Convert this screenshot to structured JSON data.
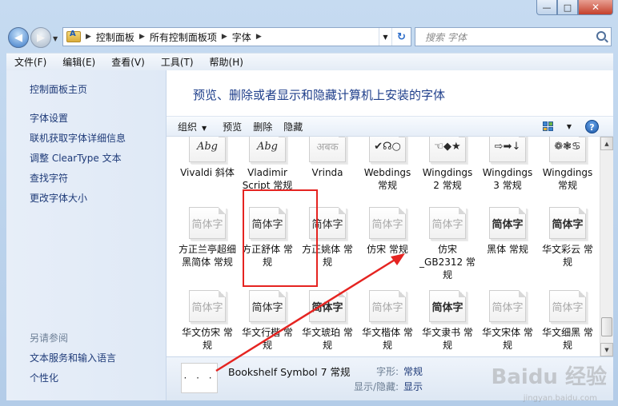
{
  "window": {
    "caption": {
      "minimize": "—",
      "maximize": "□",
      "close": "✕"
    }
  },
  "nav": {
    "back": "◀",
    "forward": "▶",
    "breadcrumbs": [
      "控制面板",
      "所有控制面板项",
      "字体"
    ],
    "search_placeholder": "搜索 字体"
  },
  "menu": [
    "文件(F)",
    "编辑(E)",
    "查看(V)",
    "工具(T)",
    "帮助(H)"
  ],
  "left_pane": {
    "links": [
      "控制面板主页",
      "字体设置",
      "联机获取字体详细信息",
      "调整 ClearType 文本",
      "查找字符",
      "更改字体大小"
    ],
    "see_also_heading": "另请参阅",
    "see_also_links": [
      "文本服务和输入语言",
      "个性化"
    ]
  },
  "main": {
    "title": "预览、删除或者显示和隐藏计算机上安装的字体",
    "commands": {
      "organize": "组织",
      "preview": "预览",
      "delete": "删除",
      "hide": "隐藏"
    },
    "help": "?"
  },
  "fonts": [
    {
      "glyph": "Abg",
      "style": "italic",
      "label": "Vivaldi 斜体"
    },
    {
      "glyph": "Abg",
      "style": "italic",
      "label": "Vladimir Script 常规"
    },
    {
      "glyph": "अबक",
      "style": "light",
      "label": "Vrinda"
    },
    {
      "glyph": "✔☊○",
      "style": "",
      "label": "Webdings 常规"
    },
    {
      "glyph": "☜◆★",
      "style": "",
      "label": "Wingdings 2 常规"
    },
    {
      "glyph": "⇨➡↓",
      "style": "",
      "label": "Wingdings 3 常规"
    },
    {
      "glyph": "❁❃♋",
      "style": "",
      "label": "Wingdings 常规"
    },
    {
      "glyph": "简体字",
      "style": "light",
      "label": "方正兰亭超细黑简体 常规"
    },
    {
      "glyph": "简体字",
      "style": "serif",
      "label": "方正舒体 常规"
    },
    {
      "glyph": "简体字",
      "style": "",
      "label": "方正姚体 常规"
    },
    {
      "glyph": "简体字",
      "style": "light",
      "label": "仿宋 常规"
    },
    {
      "glyph": "简体字",
      "style": "light",
      "label": "仿宋_GB2312 常规"
    },
    {
      "glyph": "简体字",
      "style": "bold",
      "label": "黑体 常规"
    },
    {
      "glyph": "简体字",
      "style": "bold",
      "label": "华文彩云 常规"
    },
    {
      "glyph": "简体字",
      "style": "light",
      "label": "华文仿宋 常规"
    },
    {
      "glyph": "简体字",
      "style": "serif",
      "label": "华文行楷 常规"
    },
    {
      "glyph": "简体字",
      "style": "bold",
      "label": "华文琥珀 常规"
    },
    {
      "glyph": "简体字",
      "style": "light",
      "label": "华文楷体 常规"
    },
    {
      "glyph": "简体字",
      "style": "bold",
      "label": "华文隶书 常规"
    },
    {
      "glyph": "简体字",
      "style": "light",
      "label": "华文宋体 常规"
    },
    {
      "glyph": "简体字",
      "style": "light",
      "label": "华文细黑 常规"
    }
  ],
  "details": {
    "icon_glyph": "·  ·  ·",
    "name": "Bookshelf Symbol 7 常规",
    "style_key": "字形:",
    "style_value": "常规",
    "visibility_key": "显示/隐藏:",
    "visibility_value": "显示"
  },
  "watermark": {
    "brand": "Baidu 经验",
    "url": "jingyan.baidu.com"
  },
  "colors": {
    "highlight": "#e52421",
    "link": "#1e3a78",
    "title": "#1f3f8b"
  }
}
